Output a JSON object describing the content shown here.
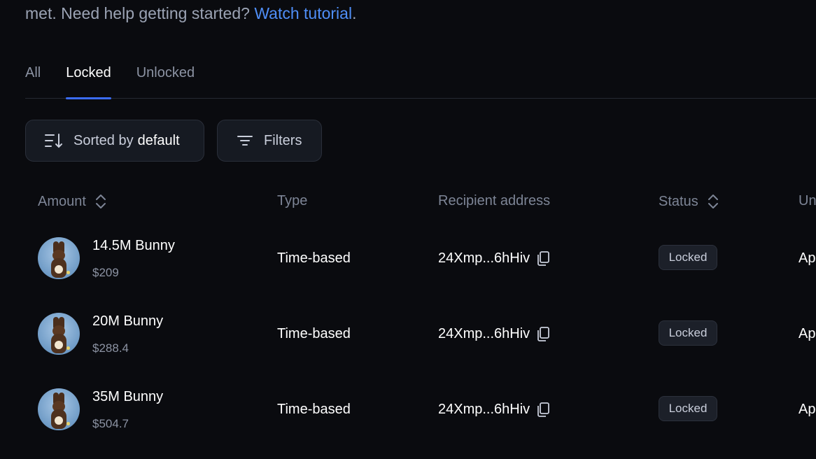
{
  "intro": {
    "text": "met. Need help getting started? ",
    "link": "Watch tutorial",
    "period": "."
  },
  "tabs": [
    {
      "label": "All",
      "active": false
    },
    {
      "label": "Locked",
      "active": true
    },
    {
      "label": "Unlocked",
      "active": false
    }
  ],
  "toolbar": {
    "sort_prefix": "Sorted by",
    "sort_value": "default",
    "filters_label": "Filters"
  },
  "table": {
    "headers": {
      "amount": "Amount",
      "type": "Type",
      "recipient": "Recipient address",
      "status": "Status",
      "unlock": "Un"
    },
    "rows": [
      {
        "amount": "14.5M Bunny",
        "usd": "$209",
        "type": "Time-based",
        "address": "24Xmp...6hHiv",
        "status": "Locked",
        "unlock": "Ap"
      },
      {
        "amount": "20M Bunny",
        "usd": "$288.4",
        "type": "Time-based",
        "address": "24Xmp...6hHiv",
        "status": "Locked",
        "unlock": "Ap"
      },
      {
        "amount": "35M Bunny",
        "usd": "$504.7",
        "type": "Time-based",
        "address": "24Xmp...6hHiv",
        "status": "Locked",
        "unlock": "Ap"
      }
    ]
  },
  "icons": {
    "sort": "sort-descending-icon",
    "filter": "filter-lines-icon",
    "sort_arrows": "chevron-up-down-icon",
    "copy": "copy-icon",
    "token": "bunny-token-avatar"
  },
  "colors": {
    "background": "#0a0b0f",
    "accent": "#3b6cf6",
    "link": "#4f8ef7"
  }
}
